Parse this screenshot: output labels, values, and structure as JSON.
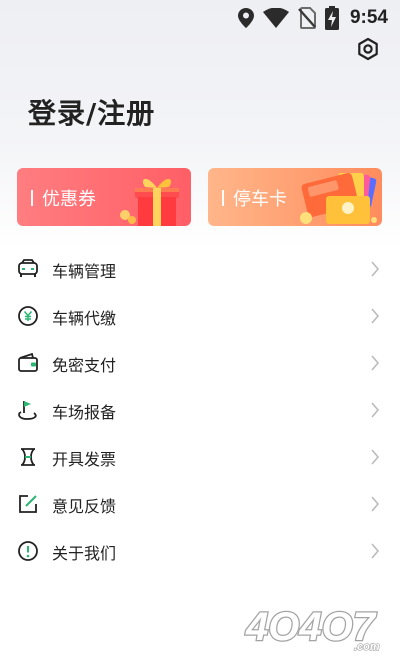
{
  "status_bar": {
    "time": "9:54",
    "icons": [
      "location-icon",
      "wifi-icon",
      "no-sim-icon",
      "battery-charging-icon"
    ]
  },
  "header": {
    "settings_icon": "gear-icon",
    "login_label": "登录/注册"
  },
  "cards": [
    {
      "label": "优惠券",
      "color": "#ff6b70",
      "icon": "gift-box-icon"
    },
    {
      "label": "停车卡",
      "color": "#ffa06e",
      "icon": "cards-stack-icon"
    }
  ],
  "menu": [
    {
      "label": "车辆管理",
      "icon": "car-icon"
    },
    {
      "label": "车辆代缴",
      "icon": "yuan-coin-icon"
    },
    {
      "label": "免密支付",
      "icon": "wallet-icon"
    },
    {
      "label": "车场报备",
      "icon": "location-flag-icon"
    },
    {
      "label": "开具发票",
      "icon": "invoice-icon"
    },
    {
      "label": "意见反馈",
      "icon": "edit-icon"
    },
    {
      "label": "关于我们",
      "icon": "info-icon"
    }
  ],
  "watermark": "4O4O7.com",
  "colors": {
    "accent_green": "#2bb673",
    "text": "#222222",
    "arrow": "#bbbbbb"
  }
}
